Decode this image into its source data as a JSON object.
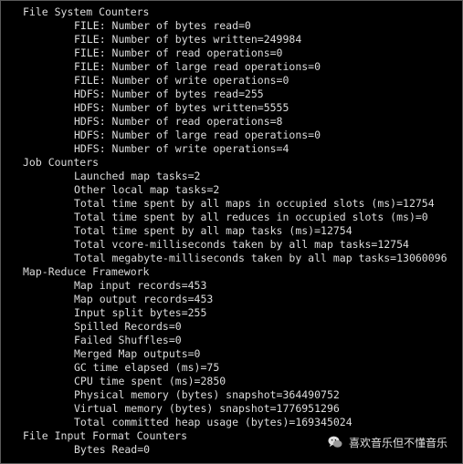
{
  "terminal": {
    "groups": [
      {
        "header": "File System Counters",
        "items": [
          "FILE: Number of bytes read=0",
          "FILE: Number of bytes written=249984",
          "FILE: Number of read operations=0",
          "FILE: Number of large read operations=0",
          "FILE: Number of write operations=0",
          "HDFS: Number of bytes read=255",
          "HDFS: Number of bytes written=5555",
          "HDFS: Number of read operations=8",
          "HDFS: Number of large read operations=0",
          "HDFS: Number of write operations=4"
        ]
      },
      {
        "header": "Job Counters",
        "items": [
          "Launched map tasks=2",
          "Other local map tasks=2",
          "Total time spent by all maps in occupied slots (ms)=12754",
          "Total time spent by all reduces in occupied slots (ms)=0",
          "Total time spent by all map tasks (ms)=12754",
          "Total vcore-milliseconds taken by all map tasks=12754",
          "Total megabyte-milliseconds taken by all map tasks=13060096"
        ]
      },
      {
        "header": "Map-Reduce Framework",
        "items": [
          "Map input records=453",
          "Map output records=453",
          "Input split bytes=255",
          "Spilled Records=0",
          "Failed Shuffles=0",
          "Merged Map outputs=0",
          "GC time elapsed (ms)=75",
          "CPU time spent (ms)=2850",
          "Physical memory (bytes) snapshot=364490752",
          "Virtual memory (bytes) snapshot=1776951296",
          "Total committed heap usage (bytes)=169345024"
        ]
      },
      {
        "header": "File Input Format Counters",
        "items": [
          "Bytes Read=0"
        ]
      }
    ]
  },
  "watermark": {
    "text": "喜欢音乐但不懂音乐",
    "icon": "wechat-icon",
    "color": "#e0e0e0"
  }
}
